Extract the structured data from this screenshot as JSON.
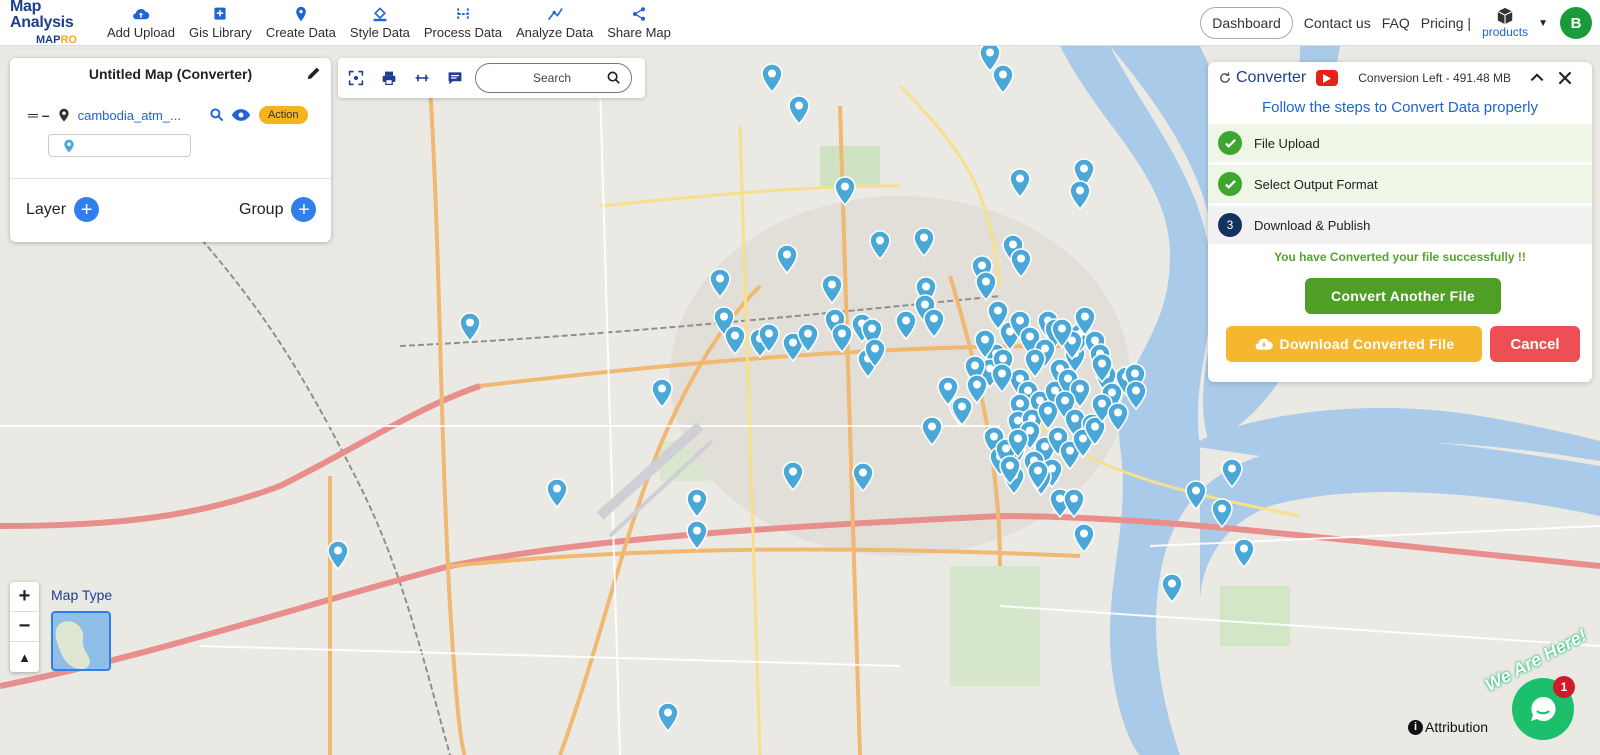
{
  "brand": {
    "title": "Map Analysis",
    "logo_left": "MAP",
    "logo_right": "RO"
  },
  "nav": [
    {
      "label": "Add Upload",
      "icon": "cloud-upload-icon"
    },
    {
      "label": "Gis Library",
      "icon": "library-icon"
    },
    {
      "label": "Create Data",
      "icon": "map-pin-icon"
    },
    {
      "label": "Style Data",
      "icon": "paint-bucket-icon"
    },
    {
      "label": "Process Data",
      "icon": "process-icon"
    },
    {
      "label": "Analyze Data",
      "icon": "analyze-icon"
    },
    {
      "label": "Share Map",
      "icon": "share-icon"
    }
  ],
  "header_right": {
    "dashboard": "Dashboard",
    "contact": "Contact us",
    "faq": "FAQ",
    "pricing": "Pricing |",
    "products": "products",
    "avatar": "B"
  },
  "left_panel": {
    "title": "Untitled Map (Converter)",
    "layer_name": "cambodia_atm_...",
    "action": "Action",
    "layer_label": "Layer",
    "group_label": "Group"
  },
  "toolbar": {
    "search_placeholder": "Search"
  },
  "converter": {
    "title": "Converter",
    "conversion_left": "Conversion Left - 491.48 MB",
    "subtitle": "Follow the steps to Convert Data properly",
    "steps": [
      {
        "label": "File Upload",
        "status": "done"
      },
      {
        "label": "Select Output Format",
        "status": "done"
      },
      {
        "label": "Download & Publish",
        "status": "current",
        "number": "3"
      }
    ],
    "success": "You have Converted your file successfully !!",
    "convert_another": "Convert Another File",
    "download": "Download Converted File",
    "cancel": "Cancel"
  },
  "map_controls": {
    "zoom_in": "+",
    "zoom_out": "−",
    "map_type": "Map Type",
    "attribution": "Attribution"
  },
  "chat": {
    "badge": "1",
    "tagline": "We Are Here!"
  },
  "colors": {
    "pin": "#4aa8d8",
    "accent": "#1e64d8",
    "success": "#4f9e25",
    "download": "#f6b730",
    "cancel": "#ee4f55"
  }
}
